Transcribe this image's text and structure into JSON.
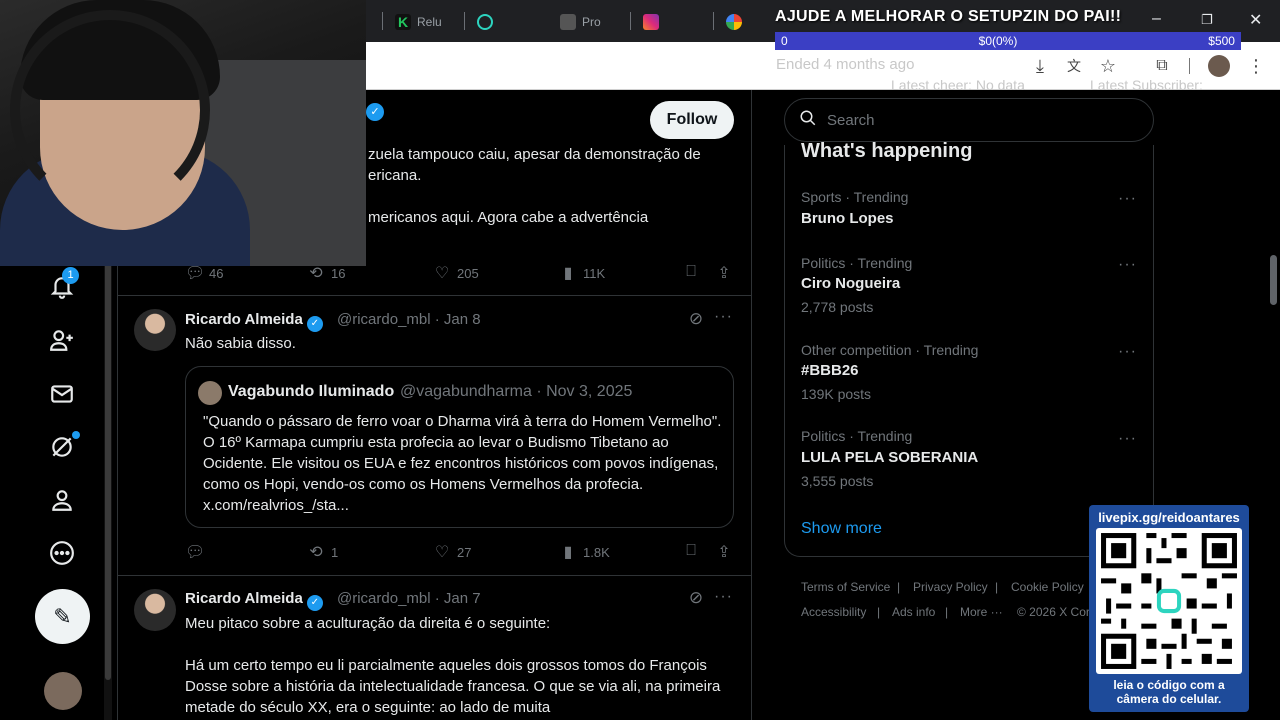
{
  "browser": {
    "tabs": [
      {
        "label": "Relu",
        "color": "#22c55e"
      },
      {
        "label": "",
        "color": "#2dd4bf"
      },
      {
        "label": "Pro",
        "color": "#9aa0a6"
      },
      {
        "label": "",
        "color": "#e1306c"
      },
      {
        "label": "",
        "color": "#4285f4"
      }
    ]
  },
  "overlay": {
    "title": "AJUDE A MELHORAR O SETUPZIN DO PAI!!",
    "goal_start": "0",
    "goal_current": "$0(0%)",
    "goal_end": "$500",
    "ended": "Ended 4 months ago",
    "latest_cheer": "Latest cheer: No data",
    "latest_subscriber": "Latest Subscriber:"
  },
  "nav": {
    "notifications_badge": "1"
  },
  "timeline": {
    "follow_label": "Follow",
    "tweet1": {
      "line1": "zuela tampouco caiu, apesar da demonstração de",
      "line2": "ericana.",
      "line3": "mericanos aqui. Agora cabe a advertência",
      "replies": "46",
      "reposts": "16",
      "likes": "205",
      "views": "11K"
    },
    "tweet2": {
      "name": "Ricardo Almeida",
      "handle_date": "@ricardo_mbl · Jan 8",
      "text": "Não sabia disso.",
      "quote": {
        "name": "Vagabundo Iluminado",
        "handle_date": "@vagabundharma · Nov 3, 2025",
        "text": "\"Quando  o pássaro de ferro voar o Dharma virá à terra do Homem Vermelho\". O 16º Karmapa cumpriu esta profecia ao levar o Budismo Tibetano ao Ocidente. Ele visitou os EUA e fez encontros históricos com povos indígenas, como  os Hopi, vendo-os como os Homens Vermelhos da profecia. x.com/realvrios_/sta..."
      },
      "replies": "",
      "reposts": "1",
      "likes": "27",
      "views": "1.8K"
    },
    "tweet3": {
      "name": "Ricardo Almeida",
      "handle_date": "@ricardo_mbl · Jan 7",
      "text_line1": "Meu pitaco sobre a aculturação da direita é o seguinte:",
      "text_para2": "Há um certo tempo eu li parcialmente aqueles dois grossos tomos do François Dosse sobre a história da intelectualidade francesa. O que se via ali, na primeira metade do século XX, era o seguinte: ao lado de muita"
    }
  },
  "sidebar": {
    "search_placeholder": "Search",
    "trends_title": "What's happening",
    "trends": [
      {
        "meta": "Sports · Trending",
        "name": "Bruno Lopes",
        "count": ""
      },
      {
        "meta": "Politics · Trending",
        "name": "Ciro Nogueira",
        "count": "2,778 posts"
      },
      {
        "meta": "Other competition · Trending",
        "name": "#BBB26",
        "count": "139K posts"
      },
      {
        "meta": "Politics · Trending",
        "name": "LULA PELA SOBERANIA",
        "count": "3,555 posts"
      }
    ],
    "show_more": "Show more",
    "footer": {
      "terms": "Terms of Service",
      "privacy": "Privacy Policy",
      "cookie": "Cookie Policy",
      "accessibility": "Accessibility",
      "ads": "Ads info",
      "more": "More ···",
      "copyright": "© 2026 X Cor"
    }
  },
  "qr": {
    "title": "livepix.gg/reidoantares",
    "caption1": "leia o código com a",
    "caption2": "câmera do celular."
  }
}
